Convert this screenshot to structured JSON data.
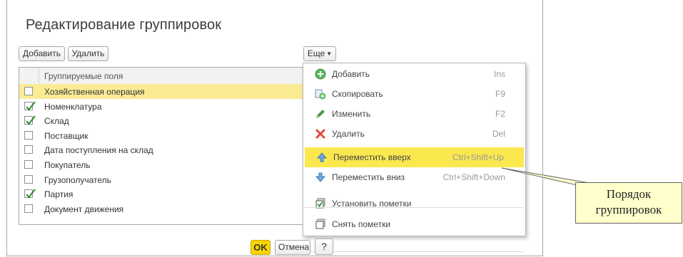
{
  "window": {
    "title": "Редактирование группировок"
  },
  "toolbar": {
    "add_label": "Добавить",
    "delete_label": "Удалить",
    "more_label": "Еще"
  },
  "grid": {
    "header": "Группируемые поля",
    "rows": [
      {
        "label": "Хозяйственная операция",
        "checked": false,
        "selected": true
      },
      {
        "label": "Номенклатура",
        "checked": true
      },
      {
        "label": "Склад",
        "checked": true
      },
      {
        "label": "Поставщик",
        "checked": false
      },
      {
        "label": "Дата поступления на склад",
        "checked": false
      },
      {
        "label": "Покупатель",
        "checked": false
      },
      {
        "label": "Грузополучатель",
        "checked": false
      },
      {
        "label": "Партия",
        "checked": true
      },
      {
        "label": "Документ движения",
        "checked": false
      }
    ]
  },
  "menu": {
    "items": [
      {
        "label": "Добавить",
        "hotkey": "Ins",
        "icon": "add-icon"
      },
      {
        "label": "Скопировать",
        "hotkey": "F9",
        "icon": "copy-icon"
      },
      {
        "label": "Изменить",
        "hotkey": "F2",
        "icon": "pencil-icon"
      },
      {
        "label": "Удалить",
        "hotkey": "Del",
        "icon": "delete-icon"
      },
      {
        "label": "Переместить вверх",
        "hotkey": "Ctrl+Shift+Up",
        "icon": "arrow-up-icon",
        "active": true
      },
      {
        "label": "Переместить вниз",
        "hotkey": "Ctrl+Shift+Down",
        "icon": "arrow-down-icon"
      },
      {
        "label": "Установить пометки",
        "hotkey": "",
        "icon": "set-marks-icon"
      },
      {
        "label": "Снять пометки",
        "hotkey": "",
        "icon": "clear-marks-icon"
      }
    ]
  },
  "footer": {
    "ok_label": "OK",
    "cancel_label": "Отмена",
    "help_label": "?"
  },
  "callout": {
    "line1": "Порядок",
    "line2": "группировок"
  },
  "colors": {
    "selection": "#fbeb95",
    "menu_active": "#fbe84f",
    "ok_button": "#fbd500",
    "check": "#2e8b2e",
    "callout_bg": "#ffffcc"
  }
}
